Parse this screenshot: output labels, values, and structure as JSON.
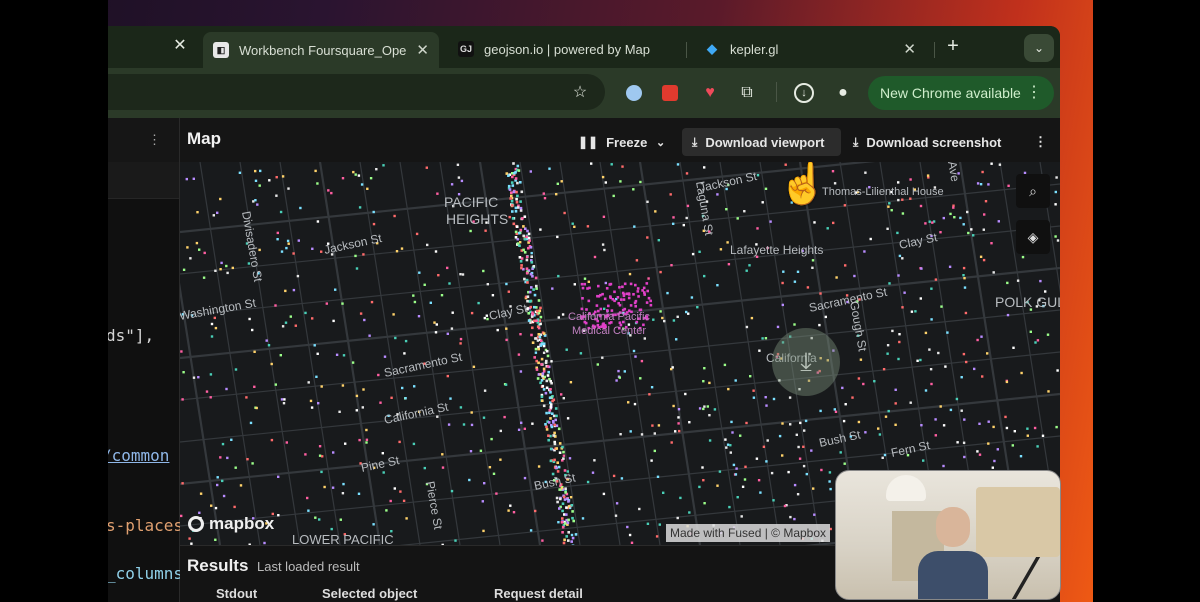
{
  "browser": {
    "tabs": [
      {
        "title": "Workbench Foursquare_Ope",
        "favicon": "fused-logo-icon",
        "active": true
      },
      {
        "title": "geojson.io | powered by Map",
        "favicon_text": "GJ",
        "active": false
      },
      {
        "title": "kepler.gl",
        "favicon": "kepler-diamond-icon",
        "active": false
      }
    ],
    "new_tab_label": "+",
    "update_button": "New Chrome available"
  },
  "code_fragments": [
    "ds\"],",
    "/common",
    "s-places",
    "_columns"
  ],
  "map_panel": {
    "title": "Map",
    "freeze_label": "Freeze",
    "download_viewport_label": "Download viewport",
    "download_screenshot_label": "Download screenshot",
    "attribution": "Made with Fused | © Mapbox",
    "logo_text": "mapbox",
    "labels": [
      "PACIFIC",
      "HEIGHTS",
      "Jackson St",
      "Washington St",
      "Clay St",
      "Sacramento St",
      "California St",
      "Pine St",
      "Bush St",
      "Divisadero St",
      "Pierce St",
      "Laguna St",
      "Lafayette Heights",
      "Clay St",
      "Sacramento St",
      "California",
      "Bush St",
      "Fern St",
      "Gough St",
      "Jackson St",
      "POLK GUL",
      "California Pacific",
      "Medical Center",
      "Thomas-Lilienthal House",
      "LOWER PACIFIC",
      "Ave"
    ]
  },
  "results": {
    "title": "Results",
    "subtitle": "Last loaded result",
    "tabs": [
      "Stdout",
      "Selected object",
      "Request detail"
    ]
  },
  "colors": {
    "accent_green": "#1f5a2a",
    "map_bg": "#181a1c"
  }
}
